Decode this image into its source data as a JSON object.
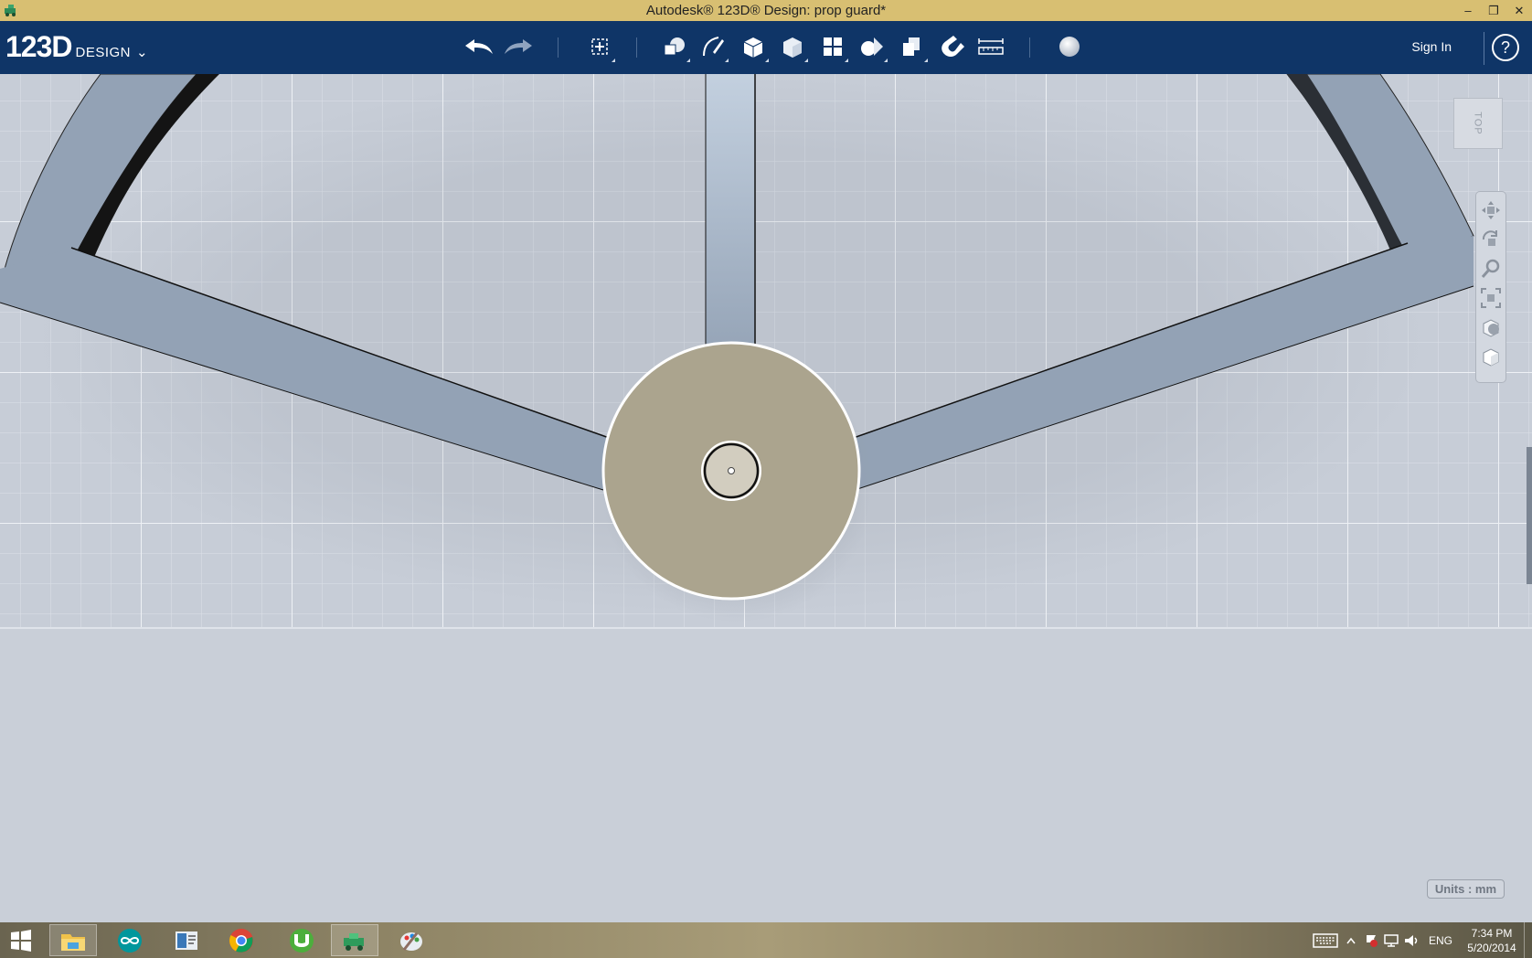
{
  "window": {
    "title": "Autodesk® 123D® Design: prop guard*",
    "minimize_glyph": "–",
    "restore_glyph": "❐",
    "close_glyph": "✕"
  },
  "appbar": {
    "logo_main": "123D",
    "logo_sub": "DESIGN",
    "logo_chevron": "⌄",
    "signin_label": "Sign In",
    "help_glyph": "?",
    "tools": [
      "undo-icon",
      "redo-icon",
      "transform-icon",
      "primitives-icon",
      "sketch-icon",
      "construct-icon",
      "modify-icon",
      "pattern-icon",
      "grouping-icon",
      "combine-icon",
      "snap-icon",
      "measure-icon",
      "material-icon"
    ]
  },
  "viewport": {
    "viewcube_label": "TOP",
    "units_label": "Units : mm",
    "colors": {
      "background": "#c9cfd8",
      "grid_minor": "#dde2e9",
      "grid_major": "#eef1f5",
      "part": "#93a2b5",
      "hub": "#aaa28d"
    }
  },
  "taskbar": {
    "items": [
      "windows-start-icon",
      "file-explorer-icon",
      "arduino-icon",
      "reader-icon",
      "chrome-icon",
      "utorrent-icon",
      "123d-design-icon",
      "paint-icon"
    ],
    "language": "ENG",
    "time": "7:34 PM",
    "date": "5/20/2014"
  }
}
